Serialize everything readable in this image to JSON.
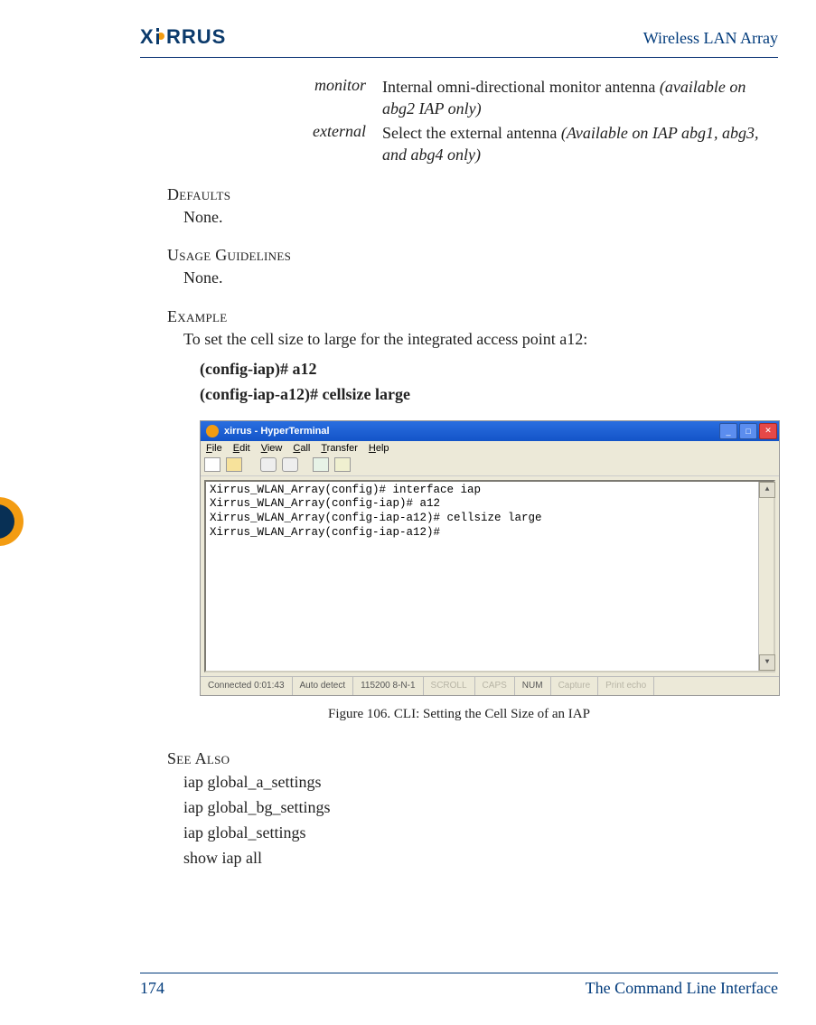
{
  "header": {
    "logo_text": "XIRRUS",
    "title": "Wireless LAN Array"
  },
  "spec": {
    "monitor": {
      "term": "monitor",
      "desc_a": "Internal omni-directional monitor antenna ",
      "desc_i": "(available on abg2 IAP only)"
    },
    "external": {
      "term": "external",
      "desc_a": "Select the external antenna ",
      "desc_i": "(Available on IAP abg1, abg3, and abg4 only)"
    }
  },
  "defaults": {
    "heading": "Defaults",
    "body": "None."
  },
  "usage": {
    "heading": "Usage Guidelines",
    "body": "None."
  },
  "example": {
    "heading": "Example",
    "intro": "To set the cell size to large for the integrated access point a12:",
    "cmd1": "(config-iap)# a12",
    "cmd2": "(config-iap-a12)# cellsize large"
  },
  "terminal": {
    "title": "xirrus - HyperTerminal",
    "menus": [
      "File",
      "Edit",
      "View",
      "Call",
      "Transfer",
      "Help"
    ],
    "lines": [
      "Xirrus_WLAN_Array(config)# interface iap",
      "Xirrus_WLAN_Array(config-iap)# a12",
      "Xirrus_WLAN_Array(config-iap-a12)# cellsize large",
      "Xirrus_WLAN_Array(config-iap-a12)#"
    ],
    "status": {
      "conn": "Connected 0:01:43",
      "auto": "Auto detect",
      "baud": "115200 8-N-1",
      "scroll": "SCROLL",
      "caps": "CAPS",
      "num": "NUM",
      "capture": "Capture",
      "echo": "Print echo"
    }
  },
  "figure_caption": "Figure 106. CLI: Setting the Cell Size of an IAP",
  "seealso": {
    "heading": "See Also",
    "items": [
      "iap global_a_settings",
      "iap global_bg_settings",
      "iap global_settings",
      "show iap all"
    ]
  },
  "footer": {
    "page": "174",
    "chapter": "The Command Line Interface"
  }
}
